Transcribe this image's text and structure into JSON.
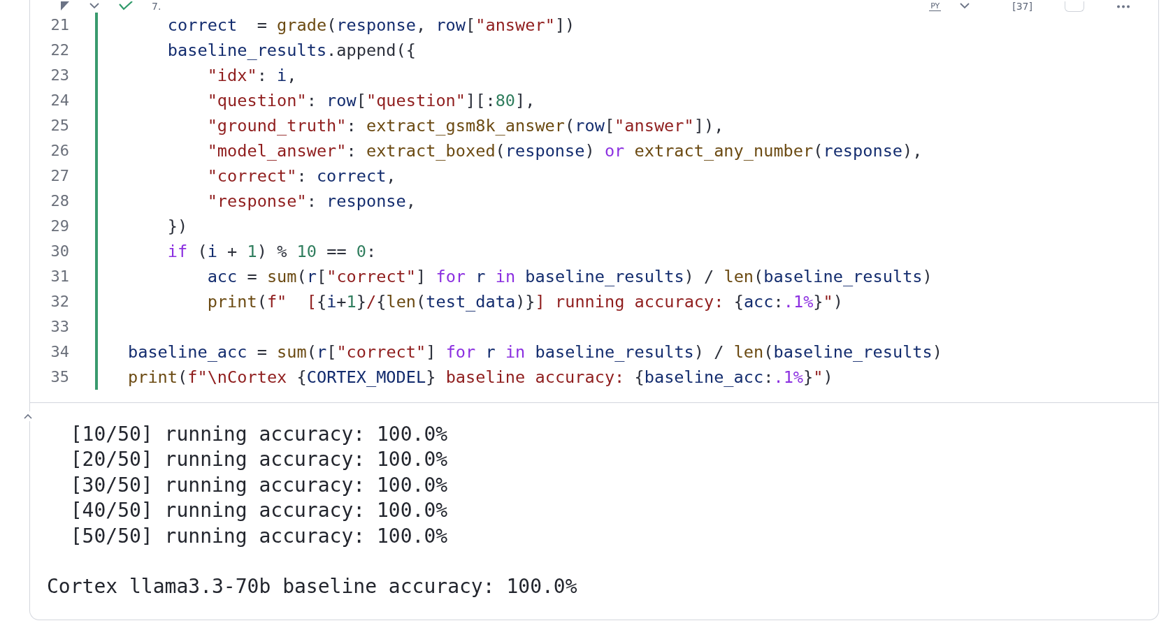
{
  "cell_toolbar": {
    "succeeded": true,
    "cell_number": "7.",
    "language": "PY",
    "execution_count": "[37]",
    "checked": false
  },
  "code": {
    "modified": true,
    "lines": [
      {
        "number": "21",
        "tokens": [
          {
            "kind": "name",
            "text": "    correct"
          },
          {
            "kind": "punct",
            "text": "  = "
          },
          {
            "kind": "func",
            "text": "grade"
          },
          {
            "kind": "punct",
            "text": "("
          },
          {
            "kind": "name",
            "text": "response"
          },
          {
            "kind": "punct",
            "text": ", "
          },
          {
            "kind": "name",
            "text": "row"
          },
          {
            "kind": "punct",
            "text": "["
          },
          {
            "kind": "string",
            "text": "\"answer\""
          },
          {
            "kind": "punct",
            "text": "])"
          }
        ]
      },
      {
        "number": "22",
        "tokens": [
          {
            "kind": "name",
            "text": "    baseline_results"
          },
          {
            "kind": "punct",
            "text": ".append({"
          }
        ]
      },
      {
        "number": "23",
        "tokens": [
          {
            "kind": "string",
            "text": "        \"idx\""
          },
          {
            "kind": "punct",
            "text": ": "
          },
          {
            "kind": "name",
            "text": "i"
          },
          {
            "kind": "punct",
            "text": ","
          }
        ]
      },
      {
        "number": "24",
        "tokens": [
          {
            "kind": "string",
            "text": "        \"question\""
          },
          {
            "kind": "punct",
            "text": ": "
          },
          {
            "kind": "name",
            "text": "row"
          },
          {
            "kind": "punct",
            "text": "["
          },
          {
            "kind": "string",
            "text": "\"question\""
          },
          {
            "kind": "punct",
            "text": "][:"
          },
          {
            "kind": "number",
            "text": "80"
          },
          {
            "kind": "punct",
            "text": "],"
          }
        ]
      },
      {
        "number": "25",
        "tokens": [
          {
            "kind": "string",
            "text": "        \"ground_truth\""
          },
          {
            "kind": "punct",
            "text": ": "
          },
          {
            "kind": "func",
            "text": "extract_gsm8k_answer"
          },
          {
            "kind": "punct",
            "text": "("
          },
          {
            "kind": "name",
            "text": "row"
          },
          {
            "kind": "punct",
            "text": "["
          },
          {
            "kind": "string",
            "text": "\"answer\""
          },
          {
            "kind": "punct",
            "text": "]),"
          }
        ]
      },
      {
        "number": "26",
        "tokens": [
          {
            "kind": "string",
            "text": "        \"model_answer\""
          },
          {
            "kind": "punct",
            "text": ": "
          },
          {
            "kind": "func",
            "text": "extract_boxed"
          },
          {
            "kind": "punct",
            "text": "("
          },
          {
            "kind": "name",
            "text": "response"
          },
          {
            "kind": "punct",
            "text": ") "
          },
          {
            "kind": "keyword",
            "text": "or "
          },
          {
            "kind": "func",
            "text": "extract_any_number"
          },
          {
            "kind": "punct",
            "text": "("
          },
          {
            "kind": "name",
            "text": "response"
          },
          {
            "kind": "punct",
            "text": "),"
          }
        ]
      },
      {
        "number": "27",
        "tokens": [
          {
            "kind": "string",
            "text": "        \"correct\""
          },
          {
            "kind": "punct",
            "text": ": "
          },
          {
            "kind": "name",
            "text": "correct"
          },
          {
            "kind": "punct",
            "text": ","
          }
        ]
      },
      {
        "number": "28",
        "tokens": [
          {
            "kind": "string",
            "text": "        \"response\""
          },
          {
            "kind": "punct",
            "text": ": "
          },
          {
            "kind": "name",
            "text": "response"
          },
          {
            "kind": "punct",
            "text": ","
          }
        ]
      },
      {
        "number": "29",
        "tokens": [
          {
            "kind": "punct",
            "text": "    })"
          }
        ]
      },
      {
        "number": "30",
        "tokens": [
          {
            "kind": "keyword",
            "text": "    if"
          },
          {
            "kind": "punct",
            "text": " ("
          },
          {
            "kind": "name",
            "text": "i"
          },
          {
            "kind": "punct",
            "text": " + "
          },
          {
            "kind": "number",
            "text": "1"
          },
          {
            "kind": "punct",
            "text": ") % "
          },
          {
            "kind": "number",
            "text": "10"
          },
          {
            "kind": "punct",
            "text": " == "
          },
          {
            "kind": "number",
            "text": "0"
          },
          {
            "kind": "punct",
            "text": ":"
          }
        ]
      },
      {
        "number": "31",
        "tokens": [
          {
            "kind": "name",
            "text": "        acc"
          },
          {
            "kind": "punct",
            "text": " = "
          },
          {
            "kind": "func",
            "text": "sum"
          },
          {
            "kind": "punct",
            "text": "("
          },
          {
            "kind": "name",
            "text": "r"
          },
          {
            "kind": "punct",
            "text": "["
          },
          {
            "kind": "string",
            "text": "\"correct\""
          },
          {
            "kind": "punct",
            "text": "] "
          },
          {
            "kind": "keyword",
            "text": "for "
          },
          {
            "kind": "name",
            "text": "r "
          },
          {
            "kind": "keyword",
            "text": "in "
          },
          {
            "kind": "name",
            "text": "baseline_results"
          },
          {
            "kind": "punct",
            "text": ") / "
          },
          {
            "kind": "func",
            "text": "len"
          },
          {
            "kind": "punct",
            "text": "("
          },
          {
            "kind": "name",
            "text": "baseline_results"
          },
          {
            "kind": "punct",
            "text": ")"
          }
        ]
      },
      {
        "number": "32",
        "tokens": [
          {
            "kind": "func",
            "text": "        print"
          },
          {
            "kind": "punct",
            "text": "("
          },
          {
            "kind": "string",
            "text": "f\"  ["
          },
          {
            "kind": "punct",
            "text": "{"
          },
          {
            "kind": "name",
            "text": "i"
          },
          {
            "kind": "punct",
            "text": "+"
          },
          {
            "kind": "number",
            "text": "1"
          },
          {
            "kind": "punct",
            "text": "}"
          },
          {
            "kind": "string",
            "text": "/"
          },
          {
            "kind": "punct",
            "text": "{"
          },
          {
            "kind": "func",
            "text": "len"
          },
          {
            "kind": "punct",
            "text": "("
          },
          {
            "kind": "name",
            "text": "test_data"
          },
          {
            "kind": "punct",
            "text": ")}"
          },
          {
            "kind": "string",
            "text": "] running accuracy: "
          },
          {
            "kind": "punct",
            "text": "{"
          },
          {
            "kind": "name",
            "text": "acc"
          },
          {
            "kind": "punct",
            "text": ":"
          },
          {
            "kind": "keyword",
            "text": ".1%"
          },
          {
            "kind": "punct",
            "text": "}"
          },
          {
            "kind": "string",
            "text": "\""
          },
          {
            "kind": "punct",
            "text": ")"
          }
        ]
      },
      {
        "number": "33"
      },
      {
        "number": "34",
        "tokens": [
          {
            "kind": "name",
            "text": "baseline_acc"
          },
          {
            "kind": "punct",
            "text": " = "
          },
          {
            "kind": "func",
            "text": "sum"
          },
          {
            "kind": "punct",
            "text": "("
          },
          {
            "kind": "name",
            "text": "r"
          },
          {
            "kind": "punct",
            "text": "["
          },
          {
            "kind": "string",
            "text": "\"correct\""
          },
          {
            "kind": "punct",
            "text": "] "
          },
          {
            "kind": "keyword",
            "text": "for "
          },
          {
            "kind": "name",
            "text": "r "
          },
          {
            "kind": "keyword",
            "text": "in "
          },
          {
            "kind": "name",
            "text": "baseline_results"
          },
          {
            "kind": "punct",
            "text": ") / "
          },
          {
            "kind": "func",
            "text": "len"
          },
          {
            "kind": "punct",
            "text": "("
          },
          {
            "kind": "name",
            "text": "baseline_results"
          },
          {
            "kind": "punct",
            "text": ")"
          }
        ]
      },
      {
        "number": "35",
        "tokens": [
          {
            "kind": "func",
            "text": "print"
          },
          {
            "kind": "punct",
            "text": "("
          },
          {
            "kind": "string",
            "text": "f\"\\nCortex "
          },
          {
            "kind": "punct",
            "text": "{"
          },
          {
            "kind": "name",
            "text": "CORTEX_MODEL"
          },
          {
            "kind": "punct",
            "text": "}"
          },
          {
            "kind": "string",
            "text": " baseline accuracy: "
          },
          {
            "kind": "punct",
            "text": "{"
          },
          {
            "kind": "name",
            "text": "baseline_acc"
          },
          {
            "kind": "punct",
            "text": ":"
          },
          {
            "kind": "keyword",
            "text": ".1%"
          },
          {
            "kind": "punct",
            "text": "}"
          },
          {
            "kind": "string",
            "text": "\""
          },
          {
            "kind": "punct",
            "text": ")"
          }
        ]
      }
    ]
  },
  "output": {
    "expanded": true,
    "progress_lines": [
      "  [10/50] running accuracy: 100.0%",
      "  [20/50] running accuracy: 100.0%",
      "  [30/50] running accuracy: 100.0%",
      "  [40/50] running accuracy: 100.0%",
      "  [50/50] running accuracy: 100.0%"
    ],
    "summary": "Cortex llama3.3-70b baseline accuracy: 100.0%"
  }
}
